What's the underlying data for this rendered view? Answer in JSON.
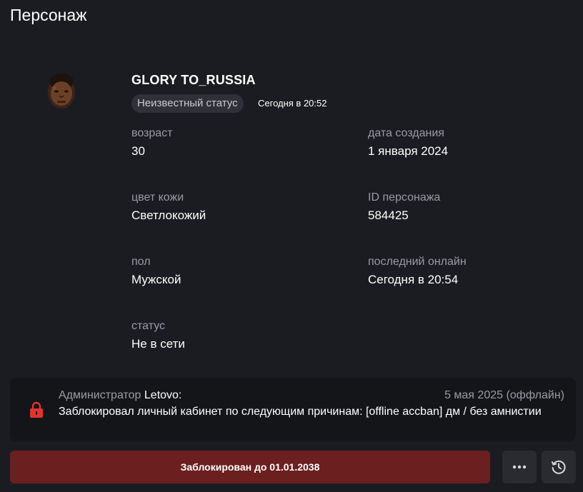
{
  "page": {
    "title": "Персонаж"
  },
  "character": {
    "name": "GLORY TO_RUSSIA",
    "status_pill": "Неизвестный статус",
    "status_time": "Сегодня в 20:52",
    "avatar": "avatar-face"
  },
  "fields": {
    "age": {
      "label": "возраст",
      "value": "30"
    },
    "created": {
      "label": "дата создания",
      "value": "1 января 2024"
    },
    "skin": {
      "label": "цвет кожи",
      "value": "Светлокожий"
    },
    "char_id": {
      "label": "ID персонажа",
      "value": "584425"
    },
    "gender": {
      "label": "пол",
      "value": "Мужской"
    },
    "last_online": {
      "label": "последний онлайн",
      "value": "Сегодня в 20:54"
    },
    "status": {
      "label": "статус",
      "value": "Не в сети"
    }
  },
  "ban": {
    "admin_prefix": "Администратор",
    "admin_name": "Letovo:",
    "date": "5 мая 2025 (оффлайн)",
    "reason": "Заблокировал личный кабинет по следующим причинам: [offline accban] дм / без амнистии",
    "icon": "lock-icon"
  },
  "actions": {
    "blocked_label": "Заблокирован до 01.01.2038",
    "more_icon": "more-icon",
    "history_icon": "clock-icon"
  },
  "colors": {
    "background": "#1b1c21",
    "panel": "#141519",
    "blocked": "#6b1f1f",
    "lock": "#e0342e"
  }
}
